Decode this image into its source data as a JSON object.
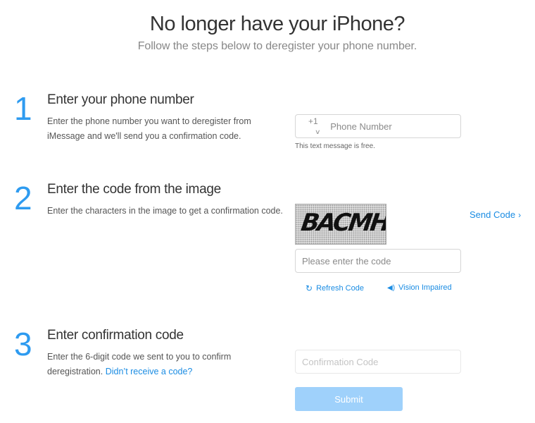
{
  "header": {
    "title": "No longer have your iPhone?",
    "subtitle": "Follow the steps below to deregister your phone number."
  },
  "steps": [
    {
      "number": "1",
      "title": "Enter your phone number",
      "description": "Enter the phone number you want to deregister from iMessage and we'll send you a confirmation code."
    },
    {
      "number": "2",
      "title": "Enter the code from the image",
      "description": "Enter the characters in the image to get a confirmation code."
    },
    {
      "number": "3",
      "title": "Enter confirmation code",
      "description": "Enter the 6-digit code we sent to you to confirm deregistration.",
      "link": "Didn’t receive a code?"
    }
  ],
  "phone": {
    "country_code": "+1",
    "placeholder": "Phone Number",
    "value": "",
    "note": "This text message is free."
  },
  "captcha": {
    "image_text": "BACMH",
    "input_placeholder": "Please enter the code",
    "input_value": "",
    "send_code_label": "Send Code",
    "refresh_label": "Refresh Code",
    "vision_label": "Vision Impaired"
  },
  "confirmation": {
    "placeholder": "Confirmation Code",
    "value": "",
    "submit_label": "Submit"
  },
  "icons": {
    "chevron_down": "⌵",
    "chevron_right": "›",
    "refresh": "↻",
    "speaker": "🔉"
  },
  "colors": {
    "accent": "#1a8ce3",
    "step_number": "#2e9bf0",
    "submit_disabled": "#9fd1fb"
  }
}
